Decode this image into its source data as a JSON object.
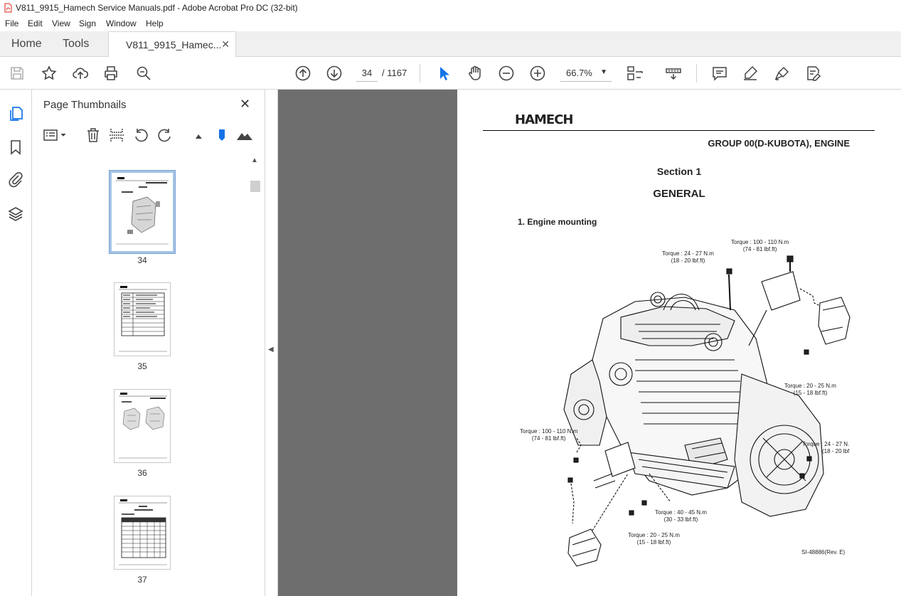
{
  "window": {
    "title": "V811_9915_Hamech Service Manuals.pdf - Adobe Acrobat Pro DC (32-bit)"
  },
  "menu": [
    "File",
    "Edit",
    "View",
    "Sign",
    "Window",
    "Help"
  ],
  "tabs": {
    "home": "Home",
    "tools": "Tools",
    "document": "V811_9915_Hamec...",
    "close_icon": "close-icon"
  },
  "toolbar": {
    "current_page": "34",
    "page_total": "/ 1167",
    "zoom": "66.7%"
  },
  "thumbnails_panel": {
    "title": "Page Thumbnails",
    "pages": [
      {
        "number": "34",
        "selected": true
      },
      {
        "number": "35",
        "selected": false
      },
      {
        "number": "36",
        "selected": false
      },
      {
        "number": "37",
        "selected": false
      }
    ]
  },
  "document_page": {
    "logo": "HAMECH",
    "group": "GROUP 00(D-KUBOTA), ENGINE",
    "section": "Section 1",
    "heading": "GENERAL",
    "subheading": "1. Engine mounting",
    "torques": [
      {
        "line1": "Torque : 100 - 110 N.m",
        "line2": "(74 - 81 lbf.ft)"
      },
      {
        "line1": "Torque : 24 - 27 N.m",
        "line2": "(18 - 20 lbf.ft)"
      },
      {
        "line1": "Torque : 20 - 25 N.m",
        "line2": "(15 - 18 lbf.ft)"
      },
      {
        "line1": "Torque : 100 - 110 N.m",
        "line2": "(74 - 81 lbf.ft)"
      },
      {
        "line1": "Torque : 24 - 27 N.",
        "line2": "(18 - 20 lbf"
      },
      {
        "line1": "Torque : 40 - 45 N.m",
        "line2": "(30 - 33 lbf.ft)"
      },
      {
        "line1": "Torque : 20 - 25 N.m",
        "line2": "(15 - 18 lbf.ft)"
      }
    ],
    "reference": "SI-48886(Rev. E)"
  },
  "colors": {
    "accent_blue": "#1473e6",
    "doc_background": "#6e6e6e",
    "pdf_red": "#e0261b"
  }
}
